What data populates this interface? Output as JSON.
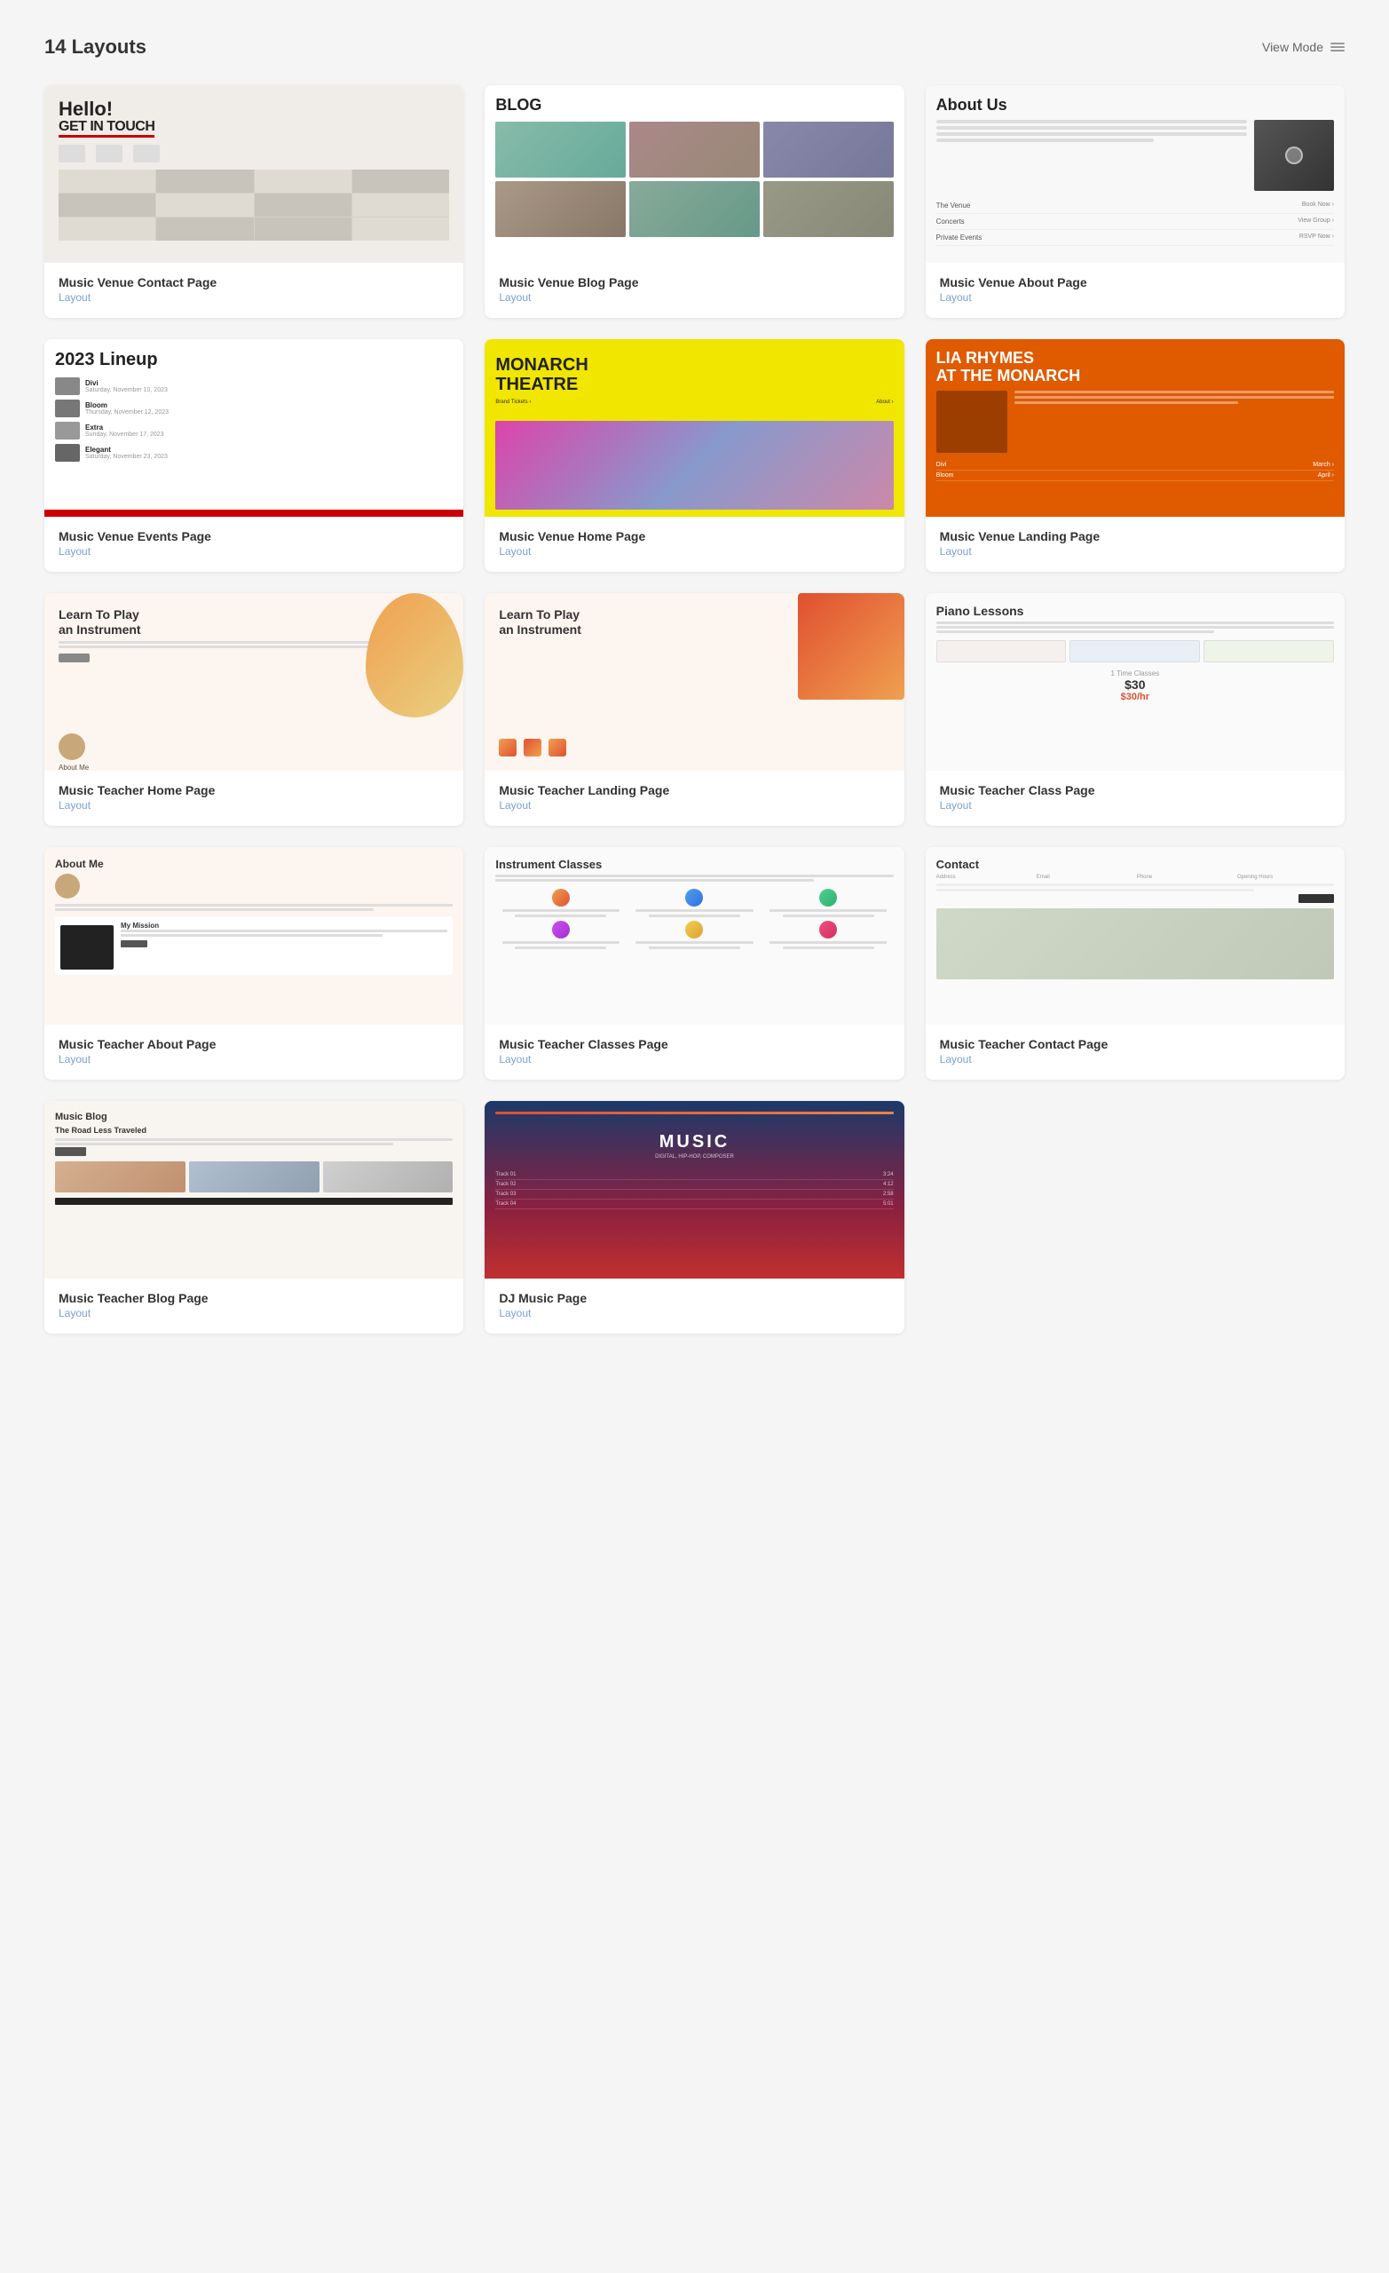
{
  "header": {
    "title": "14 Layouts",
    "viewMode": "View Mode"
  },
  "cards": [
    {
      "id": "music-venue-contact",
      "name": "Music Venue Contact Page",
      "type": "Layout",
      "previewType": "contact"
    },
    {
      "id": "music-venue-blog",
      "name": "Music Venue Blog Page",
      "type": "Layout",
      "previewType": "blog"
    },
    {
      "id": "music-venue-about",
      "name": "Music Venue About Page",
      "type": "Layout",
      "previewType": "about"
    },
    {
      "id": "music-venue-events",
      "name": "Music Venue Events Page",
      "type": "Layout",
      "previewType": "events"
    },
    {
      "id": "music-venue-home",
      "name": "Music Venue Home Page",
      "type": "Layout",
      "previewType": "home"
    },
    {
      "id": "music-venue-landing",
      "name": "Music Venue Landing Page",
      "type": "Layout",
      "previewType": "landing"
    },
    {
      "id": "music-teacher-home",
      "name": "Music Teacher Home Page",
      "type": "Layout",
      "previewType": "teacher-home"
    },
    {
      "id": "music-teacher-landing",
      "name": "Music Teacher Landing Page",
      "type": "Layout",
      "previewType": "teacher-landing"
    },
    {
      "id": "music-teacher-class",
      "name": "Music Teacher Class Page",
      "type": "Layout",
      "previewType": "teacher-class"
    },
    {
      "id": "music-teacher-about",
      "name": "Music Teacher About Page",
      "type": "Layout",
      "previewType": "teacher-about"
    },
    {
      "id": "music-teacher-classes",
      "name": "Music Teacher Classes Page",
      "type": "Layout",
      "previewType": "teacher-classes"
    },
    {
      "id": "music-teacher-contact",
      "name": "Music Teacher Contact Page",
      "type": "Layout",
      "previewType": "teacher-contact"
    },
    {
      "id": "music-teacher-blog",
      "name": "Music Teacher Blog Page",
      "type": "Layout",
      "previewType": "teacher-blog"
    },
    {
      "id": "dj-music",
      "name": "DJ Music Page",
      "type": "Layout",
      "previewType": "dj"
    }
  ],
  "previews": {
    "contact": {
      "hello": "Hello!",
      "getintouch": "GET IN TOUCH"
    },
    "blog": {
      "title": "BLOG"
    },
    "about": {
      "title": "About Us",
      "row1": "The Venue",
      "row2": "Concerts",
      "row3": "Private Events"
    },
    "events": {
      "title": "2023 Lineup",
      "items": [
        "Divi",
        "Bloom",
        "Extra",
        "Elegant"
      ]
    },
    "home": {
      "title": "MONARCH\nTHEATRE"
    },
    "landing": {
      "title": "LIA RHYMES\nAT THE MONARCH",
      "rows": [
        "Divi",
        "Bloom"
      ]
    },
    "teacherHome": {
      "title": "Learn To Play\nan Instrument",
      "aboutLabel": "About Me"
    },
    "teacherLanding": {
      "title": "Learn To Play\nan Instrument"
    },
    "teacherClass": {
      "title": "Piano Lessons",
      "priceLabel": "1 Time Classes",
      "priceValue": "$30/hr"
    },
    "teacherAbout": {
      "title": "About Me",
      "missionTitle": "My Mission"
    },
    "teacherClasses": {
      "title": "Instrument Classes"
    },
    "teacherContact": {
      "title": "Contact"
    },
    "teacherBlog": {
      "title": "Music Blog",
      "heroTitle": "The Road Less Traveled"
    },
    "dj": {
      "title": "MUSIC",
      "subtitle": "DIGITAL, HIP-HOP, COMPOSER"
    }
  }
}
